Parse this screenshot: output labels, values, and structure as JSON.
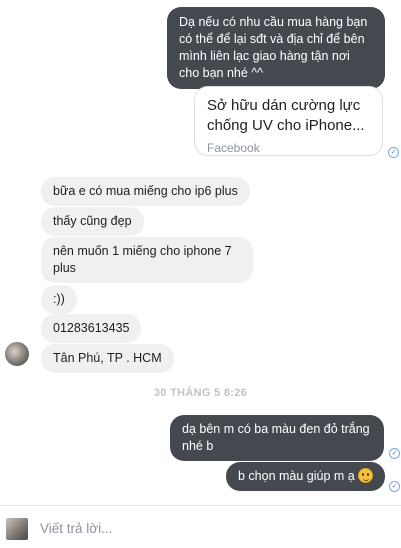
{
  "messages_out_top": {
    "text": "Dạ nếu có nhu cầu mua hàng bạn có thể để lại sđt và địa chỉ để bên mình liên lạc giao hàng tận nơi cho bạn nhé ^^"
  },
  "link_card": {
    "title": "Sở hữu dán cường lực chống UV cho iPhone...",
    "source": "Facebook"
  },
  "messages_in": [
    "bữa e có mua miếng cho ip6 plus",
    "thấy cũng đẹp",
    "nên muốn 1 miếng cho iphone 7 plus",
    ":))",
    "01283613435",
    "Tân Phú, TP . HCM"
  ],
  "timestamp": "30 THÁNG 5 8:26",
  "messages_out_bottom": [
    "dạ bên m có ba màu đen đỏ trắng nhé b",
    "b chọn màu giúp m ạ"
  ],
  "icons": {
    "read_receipt": "check-circle-icon",
    "emoji": "smiley-emoji-icon"
  },
  "composer": {
    "placeholder": "Viết trả lời..."
  }
}
